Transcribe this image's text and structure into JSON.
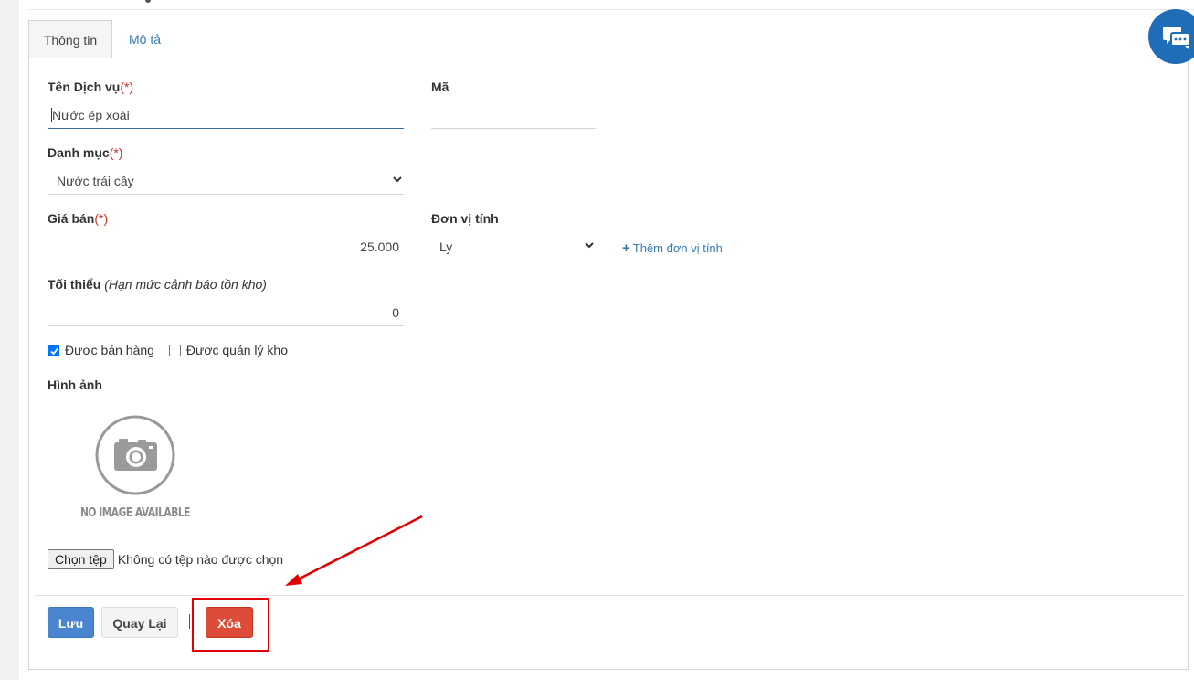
{
  "tabs": [
    {
      "label": "Thông tin",
      "active": true
    },
    {
      "label": "Mô tả",
      "active": false
    }
  ],
  "form": {
    "service_name": {
      "label": "Tên Dịch vụ",
      "required": "(*)",
      "value": "Nước ép xoài"
    },
    "code": {
      "label": "Mã",
      "value": ""
    },
    "category": {
      "label": "Danh mục",
      "required": "(*)",
      "value": "Nước trái cây"
    },
    "price": {
      "label": "Giá bán",
      "required": "(*)",
      "value": "25.000"
    },
    "unit": {
      "label": "Đơn vị tính",
      "value": "Ly",
      "add_label": "Thêm đơn vị tính"
    },
    "minimum": {
      "label": "Tối thiểu",
      "hint": "(Hạn mức cảnh báo tồn kho)",
      "value": "0"
    },
    "checkboxes": [
      {
        "label": "Được bán hàng",
        "checked": true
      },
      {
        "label": "Được quản lý kho",
        "checked": false
      }
    ],
    "image": {
      "label": "Hình ảnh",
      "placeholder_text": "NO IMAGE AVAILABLE"
    },
    "file": {
      "button_label": "Chọn tệp",
      "status": "Không có tệp nào được chọn"
    }
  },
  "actions": {
    "save": "Lưu",
    "back": "Quay Lại",
    "delete": "Xóa"
  },
  "colors": {
    "primary": "#4a86cf",
    "danger": "#dd4b39",
    "link": "#337ab7",
    "annotation": "#e00000",
    "chat": "#1e6db6"
  }
}
